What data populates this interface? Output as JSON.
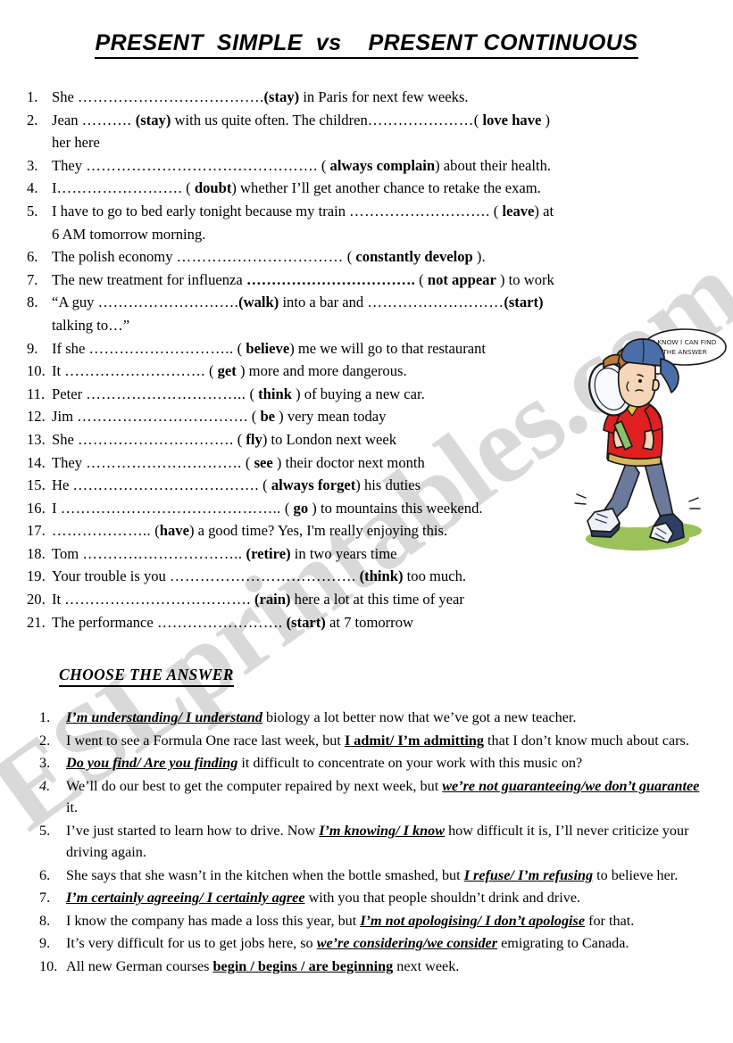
{
  "title": {
    "part1": "PRESENT  SIMPLE  vs",
    "part2": "PRESENT CONTINUOUS",
    "full": "PRESENT  SIMPLE  vs    PRESENT CONTINUOUS"
  },
  "watermark": {
    "text": "ESLprintables.com",
    "color": "#d9d9d9"
  },
  "gapfill": {
    "items": [
      {
        "num": "1.",
        "pre": "She  ",
        "dots": "……………………………….",
        "cue_open": "",
        "cue": "(stay)",
        "post": " in Paris for next few weeks.",
        "bold_dots": false
      },
      {
        "num": "2.",
        "pre": "Jean ",
        "dots": "………. ",
        "cue": "(stay)",
        "post": " with us quite often. The children",
        "dots2": "…………………",
        "cue2_pre": "( ",
        "cue2a": "love",
        "cue2gap": "   ",
        "cue2b": "have",
        "cue2_post": " )",
        "post2": " her here",
        "bold_dots": false
      },
      {
        "num": "3.",
        "pre": "They ",
        "dots": "……………………………………….",
        "cue_open": " ( ",
        "cue": "always complain",
        "cue_close": ")",
        "post": " about their health.",
        "bold_dots": false
      },
      {
        "num": "4.",
        "pre": "I",
        "dots": "…………………….",
        "cue_open": " ( ",
        "cue": "doubt",
        "cue_close": ")",
        "post": "   whether I’ll get another chance to retake the exam.",
        "bold_dots": false
      },
      {
        "num": "5.",
        "pre": "I  have to go to bed early tonight because my train  ",
        "dots": "……………………….",
        "cue_open": "  ( ",
        "cue": "leave",
        "cue_close": ")",
        "post": "  at 6 AM tomorrow morning.",
        "bold_dots": false,
        "wide": true
      },
      {
        "num": "6.",
        "pre": "The polish economy  ",
        "dots": "……………………………",
        "cue_open": "  ( ",
        "cue": "constantly   develop",
        "cue_close": " ).",
        "post": "",
        "bold_dots": false
      },
      {
        "num": "7.",
        "pre": "The new treatment for influenza ",
        "dots": "…………………………….",
        "cue_open": " ( ",
        "cue": "not appear",
        "cue_close": " )",
        "post": " to work",
        "bold_dots": true
      },
      {
        "num": "8.",
        "pre": "“A guy ",
        "dots": "……………………….",
        "cue": "(walk)",
        "post": " into a bar and ",
        "dots2": "………………………",
        "cue2": "(start)",
        "post2": " talking to…”",
        "bold_dots": false,
        "wide": true
      },
      {
        "num": "9.",
        "pre": "If she ",
        "dots": "………………………..",
        "cue_open": " ( ",
        "cue": "believe",
        "cue_close": ")",
        "post": " me we will go to that restaurant",
        "bold_dots": false
      },
      {
        "num": "10.",
        "pre": "It ",
        "dots": "……………………….",
        "cue_open": "  ( ",
        "cue": "get",
        "cue_close": " )",
        "post": " more and more dangerous.",
        "bold_dots": false
      },
      {
        "num": "11.",
        "pre": "Peter ",
        "dots": "…………………………..",
        "cue_open": " ( ",
        "cue": "think",
        "cue_close": " )",
        "post": " of buying a new car.",
        "bold_dots": false
      },
      {
        "num": "12.",
        "pre": "Jim ",
        "dots": "…………………………….",
        "cue_open": " ( ",
        "cue": "be",
        "cue_close": " )",
        "post": " very mean today",
        "bold_dots": false
      },
      {
        "num": "13.",
        "pre": "She  ",
        "dots": "………………………….",
        "cue_open": "  ( ",
        "cue": "fly",
        "cue_close": ")",
        "post": "  to London next week",
        "bold_dots": false
      },
      {
        "num": "14.",
        "pre": "They ",
        "dots": "………………………….",
        "cue_open": "  ( ",
        "cue": "see",
        "cue_close": " )",
        "post": " their doctor next month",
        "bold_dots": false
      },
      {
        "num": "15.",
        "pre": "He ",
        "dots": "……………………………….",
        "cue_open": "  ( ",
        "cue": "always forget",
        "cue_close": ")",
        "post": " his duties",
        "bold_dots": false
      },
      {
        "num": "16.",
        "pre": "I ",
        "dots": "……………………………………..",
        "cue_open": "  ( ",
        "cue": "go",
        "cue_close": " )",
        "post": " to mountains this weekend.",
        "bold_dots": false
      },
      {
        "num": "17.",
        "pre": " ",
        "dots": "………………..",
        "cue_open": "   (",
        "cue": "have",
        "cue_close": ")",
        "post": "  a good time? Yes, I'm really enjoying this.",
        "bold_dots": false
      },
      {
        "num": "18.",
        "pre": "Tom ",
        "dots": "…………………………..",
        "cue_open": " ",
        "cue": "(retire)",
        "cue_close": "",
        "post": " in two years time",
        "bold_dots": false
      },
      {
        "num": "19.",
        "pre": "Your trouble is you  ",
        "dots": "……………………………….",
        "cue_open": " ",
        "cue": "(think)",
        "cue_close": "",
        "post": "  too much.",
        "bold_dots": false
      },
      {
        "num": "20.",
        "pre": "It ",
        "dots": "……………………………….",
        "cue_open": " ",
        "cue": "(rain)",
        "cue_close": "",
        "post": " here  a lot at this time of year",
        "bold_dots": false
      },
      {
        "num": "21.",
        "pre": "The performance  ",
        "dots": "…………………….",
        "cue_open": " ",
        "cue": "(start)",
        "cue_close": "",
        "post": " at 7 tomorrow",
        "bold_dots": false
      }
    ]
  },
  "choose_section": {
    "heading": "CHOOSE THE ANSWER",
    "items": [
      {
        "num": "1.",
        "pre": "",
        "option": "I’m understanding/ I understand",
        "option_style": "italic",
        "post": " biology a lot better now that we’ve got a new teacher.",
        "italic_num": false
      },
      {
        "num": "2.",
        "pre": "I went to see a Formula One race last week, but ",
        "option": "I admit/ I’m admitting",
        "option_style": "upright",
        "post": " that I don’t know much about cars.",
        "italic_num": false
      },
      {
        "num": "3.",
        "pre": "",
        "option": "Do you find/ Are you finding",
        "option_style": "italic",
        "post": " it difficult to concentrate on your work with this music on?",
        "italic_num": false
      },
      {
        "num": "4.",
        "pre": "We’ll do our best to get the computer repaired by next week, but ",
        "option": "we’re not guaranteeing/we don’t guarantee",
        "option_style": "italic",
        "post": " it.",
        "italic_num": true
      },
      {
        "num": "5.",
        "pre": "I’ve just started to learn how to drive. Now ",
        "option": "I’m knowing/ I know",
        "option_style": "italic",
        "post": " how difficult it is, I’ll never criticize your driving again.",
        "italic_num": false
      },
      {
        "num": "6.",
        "pre": "She says that she wasn’t in the kitchen when the bottle smashed, but ",
        "option": "I refuse/ I’m refusing",
        "option_style": "italic",
        "post": " to believe her.",
        "italic_num": false
      },
      {
        "num": "7.",
        "pre": "",
        "option": "I’m certainly agreeing/ I certainly agree",
        "option_style": "italic",
        "post": " with you that people shouldn’t drink and drive.",
        "italic_num": false
      },
      {
        "num": "8.",
        "pre": "I know the company has made a loss this year, but ",
        "option": "I’m not apologising/ I don’t apologise",
        "option_style": "italic",
        "post": " for that.",
        "italic_num": false
      },
      {
        "num": "9.",
        "pre": "It’s very difficult for us to get jobs here,  so ",
        "option": "we’re considering/we consider",
        "option_style": "italic",
        "post": " emigrating to Canada.",
        "italic_num": false
      },
      {
        "num": "10.",
        "pre": "All new German courses ",
        "option": "begin / begins / are beginning",
        "option_style": "upright",
        "post": "  next week.",
        "italic_num": false
      }
    ]
  },
  "cartoon": {
    "thought_line1": "I KNOW I CAN FIND",
    "thought_line2": "THE ANSWER",
    "colors": {
      "cap": "#4a6ea8",
      "shirt": "#e02020",
      "jeans": "#6b7a9b",
      "shoes": "#2e3f63",
      "skin": "#f6d6b8",
      "hair": "#c07a3a",
      "grass": "#9bc159",
      "lens": "#eef4f7",
      "outline": "#1a1a1a"
    }
  }
}
